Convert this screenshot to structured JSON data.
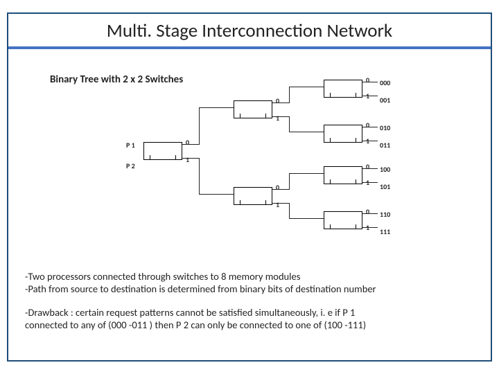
{
  "title": "Multi. Stage Interconnection Network",
  "subtitle": "Binary Tree with 2 x 2 Switches",
  "proc": {
    "p1": "P 1",
    "p2": "P 2"
  },
  "bits": {
    "zero": "0",
    "one": "1"
  },
  "mem": {
    "m0": "000",
    "m1": "001",
    "m2": "010",
    "m3": "011",
    "m4": "100",
    "m5": "101",
    "m6": "110",
    "m7": "111"
  },
  "notes": {
    "n1": "-Two processors connected through switches to 8 memory modules",
    "n2": "-Path from source to destination is determined from binary bits of destination number",
    "n3": "-Drawback : certain request patterns cannot be satisfied simultaneously,  i. e  if P 1",
    "n4": "  connected to any of (000 -011 ) then P 2 can only be connected to one of (100 -111)"
  }
}
